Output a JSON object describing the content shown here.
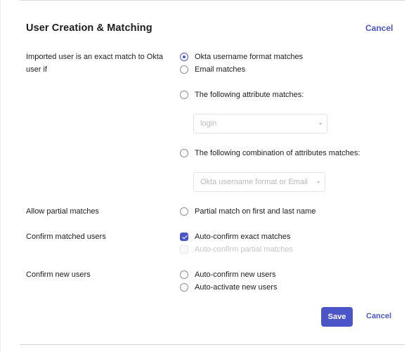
{
  "section": {
    "title": "User Creation & Matching",
    "cancel_label": "Cancel"
  },
  "exact_match": {
    "label": "Imported user is an exact match to Okta user if",
    "options": [
      {
        "label": "Okta username format matches",
        "selected": true
      },
      {
        "label": "Email matches",
        "selected": false
      },
      {
        "label": "The following attribute matches:",
        "selected": false
      },
      {
        "label": "The following combination of attributes matches:",
        "selected": false
      }
    ],
    "attribute_select_value": "login",
    "combination_select_value": "Okta username format or Email"
  },
  "partial": {
    "label": "Allow partial matches",
    "option_label": "Partial match on first and last name",
    "checked": false
  },
  "confirm_matched": {
    "label": "Confirm matched users",
    "options": [
      {
        "label": "Auto-confirm exact matches",
        "checked": true,
        "disabled": false
      },
      {
        "label": "Auto-confirm partial matches",
        "checked": false,
        "disabled": true
      }
    ]
  },
  "confirm_new": {
    "label": "Confirm new users",
    "options": [
      {
        "label": "Auto-confirm new users",
        "checked": false
      },
      {
        "label": "Auto-activate new users",
        "checked": false
      }
    ]
  },
  "footer": {
    "save_label": "Save",
    "cancel_label": "Cancel"
  },
  "colors": {
    "accent": "#4b55c8",
    "text": "#1d1d21",
    "disabled_text": "#c6c6cc",
    "border": "#d7d7dc"
  }
}
